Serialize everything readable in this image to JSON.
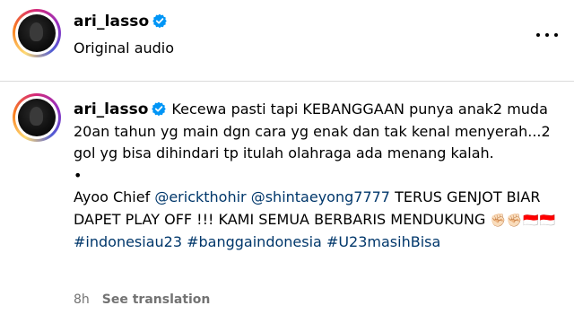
{
  "header": {
    "username": "ari_lasso",
    "subtitle": "Original audio"
  },
  "comment": {
    "username": "ari_lasso",
    "text_part1": "Kecewa pasti tapi KEBANGGAAN punya anak2 muda 20an tahun yg main dgn cara yg enak dan tak kenal menyerah...2 gol yg bisa dihindari tp itulah olahraga ada menang kalah.",
    "bullet": "•",
    "text_part2": "Ayoo Chief",
    "mention1": "@erickthohir",
    "mention2": "@shintaeyong7777",
    "text_part3": "TERUS GENJOT BIAR DAPET PLAY OFF !!! KAMI SEMUA BERBARIS MENDUKUNG",
    "emojis": "✊🏻✊🏻🇮🇩🇮🇩",
    "hashtag1": "#indonesiau23",
    "hashtag2": "#banggaindonesia",
    "hashtag3": "#U23masihBisa"
  },
  "footer": {
    "time": "8h",
    "see_translation": "See translation"
  },
  "colors": {
    "verified": "#0095f6",
    "link": "#00376b",
    "muted": "#737373",
    "divider": "#dbdbdb"
  },
  "icons": {
    "verified": "verified-badge-icon",
    "more": "more-options-icon"
  }
}
